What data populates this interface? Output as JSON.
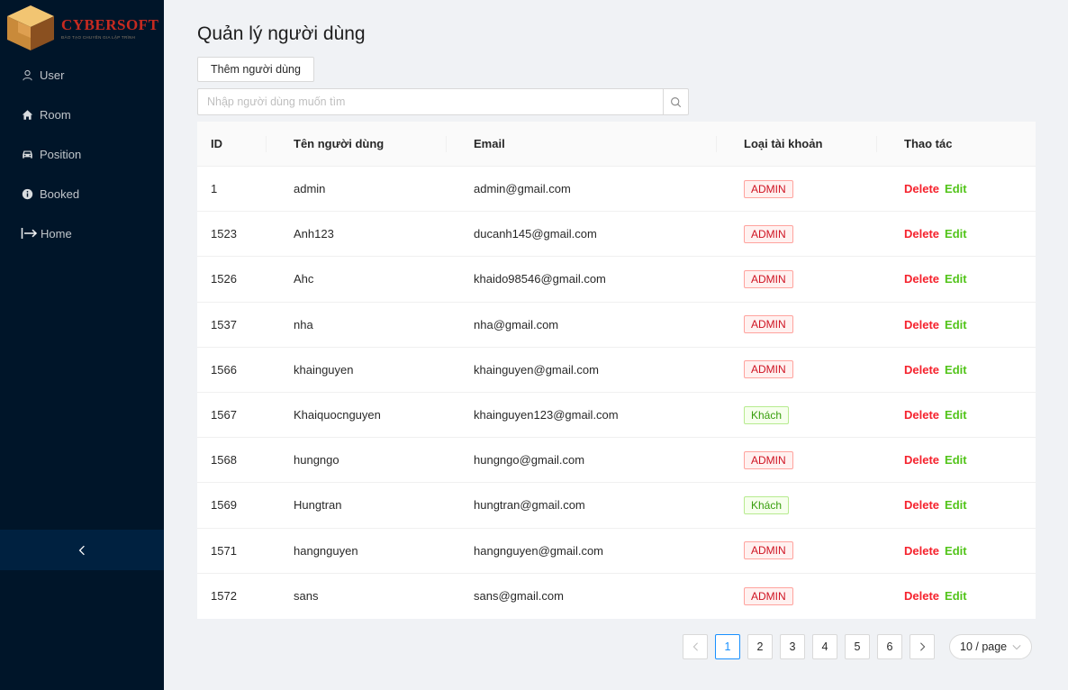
{
  "brand": {
    "name": "CYBERSOFT",
    "tagline": "ĐÀO TẠO CHUYÊN GIA LẬP TRÌNH"
  },
  "sidebar": {
    "items": [
      {
        "label": "User",
        "icon": "user-icon"
      },
      {
        "label": "Room",
        "icon": "home-icon"
      },
      {
        "label": "Position",
        "icon": "car-icon"
      },
      {
        "label": "Booked",
        "icon": "info-circle-icon"
      },
      {
        "label": "Home",
        "icon": "arrow-right-bar-icon"
      }
    ],
    "collapse_icon": "chevron-left-icon"
  },
  "page": {
    "title": "Quản lý người dùng",
    "add_button": "Thêm người dùng",
    "search_placeholder": "Nhập người dùng muốn tìm"
  },
  "table": {
    "columns": [
      "ID",
      "Tên người dùng",
      "Email",
      "Loại tài khoản",
      "Thao tác"
    ],
    "rows": [
      {
        "id": "1",
        "name": "admin",
        "email": "admin@gmail.com",
        "role": "ADMIN"
      },
      {
        "id": "1523",
        "name": "Anh123",
        "email": "ducanh145@gmail.com",
        "role": "ADMIN"
      },
      {
        "id": "1526",
        "name": "Ahc",
        "email": "khaido98546@gmail.com",
        "role": "ADMIN"
      },
      {
        "id": "1537",
        "name": "nha",
        "email": "nha@gmail.com",
        "role": "ADMIN"
      },
      {
        "id": "1566",
        "name": "khainguyen",
        "email": "khainguyen@gmail.com",
        "role": "ADMIN"
      },
      {
        "id": "1567",
        "name": "Khaiquocnguyen",
        "email": "khainguyen123@gmail.com",
        "role": "Khách"
      },
      {
        "id": "1568",
        "name": "hungngo",
        "email": "hungngo@gmail.com",
        "role": "ADMIN"
      },
      {
        "id": "1569",
        "name": "Hungtran",
        "email": "hungtran@gmail.com",
        "role": "Khách"
      },
      {
        "id": "1571",
        "name": "hangnguyen",
        "email": "hangnguyen@gmail.com",
        "role": "ADMIN"
      },
      {
        "id": "1572",
        "name": "sans",
        "email": "sans@gmail.com",
        "role": "ADMIN"
      }
    ],
    "action_delete": "Delete",
    "action_edit": "Edit"
  },
  "pagination": {
    "pages": [
      "1",
      "2",
      "3",
      "4",
      "5",
      "6"
    ],
    "current": "1",
    "page_size": "10 / page"
  },
  "colors": {
    "sider_bg": "#001529",
    "admin_tag": "#cf1322",
    "guest_tag": "#389e0d",
    "delete": "#f5222d",
    "edit": "#52c41a",
    "active_page": "#1890ff"
  }
}
